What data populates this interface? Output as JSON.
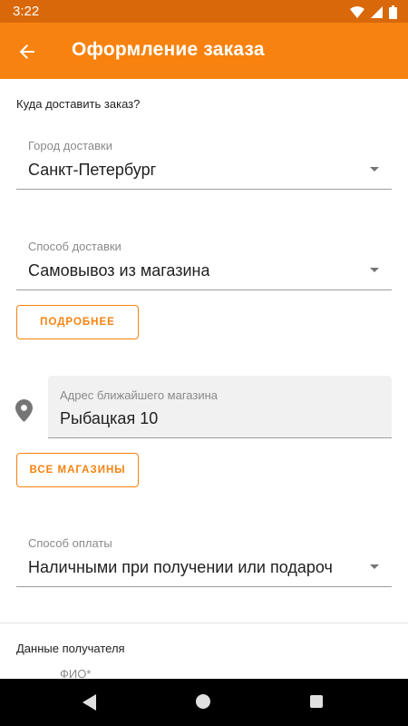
{
  "status_bar": {
    "time": "3:22"
  },
  "app_bar": {
    "title": "Оформление заказа"
  },
  "delivery": {
    "section_title": "Куда доставить заказ?",
    "city": {
      "label": "Город доставки",
      "value": "Санкт-Петербург"
    },
    "method": {
      "label": "Способ доставки",
      "value": "Самовывоз из магазина"
    },
    "details_button": "ПОДРОБНЕЕ",
    "shop": {
      "label": "Адрес ближайшего магазина",
      "value": "Рыбацкая 10"
    },
    "all_shops_button": "ВСЕ МАГАЗИНЫ"
  },
  "payment": {
    "label": "Способ оплаты",
    "value": "Наличными при получении или подароч"
  },
  "recipient": {
    "section_title": "Данные получателя",
    "full_name_label": "ФИО*"
  },
  "colors": {
    "accent": "#f7820f",
    "status_bar": "#d9680a"
  }
}
